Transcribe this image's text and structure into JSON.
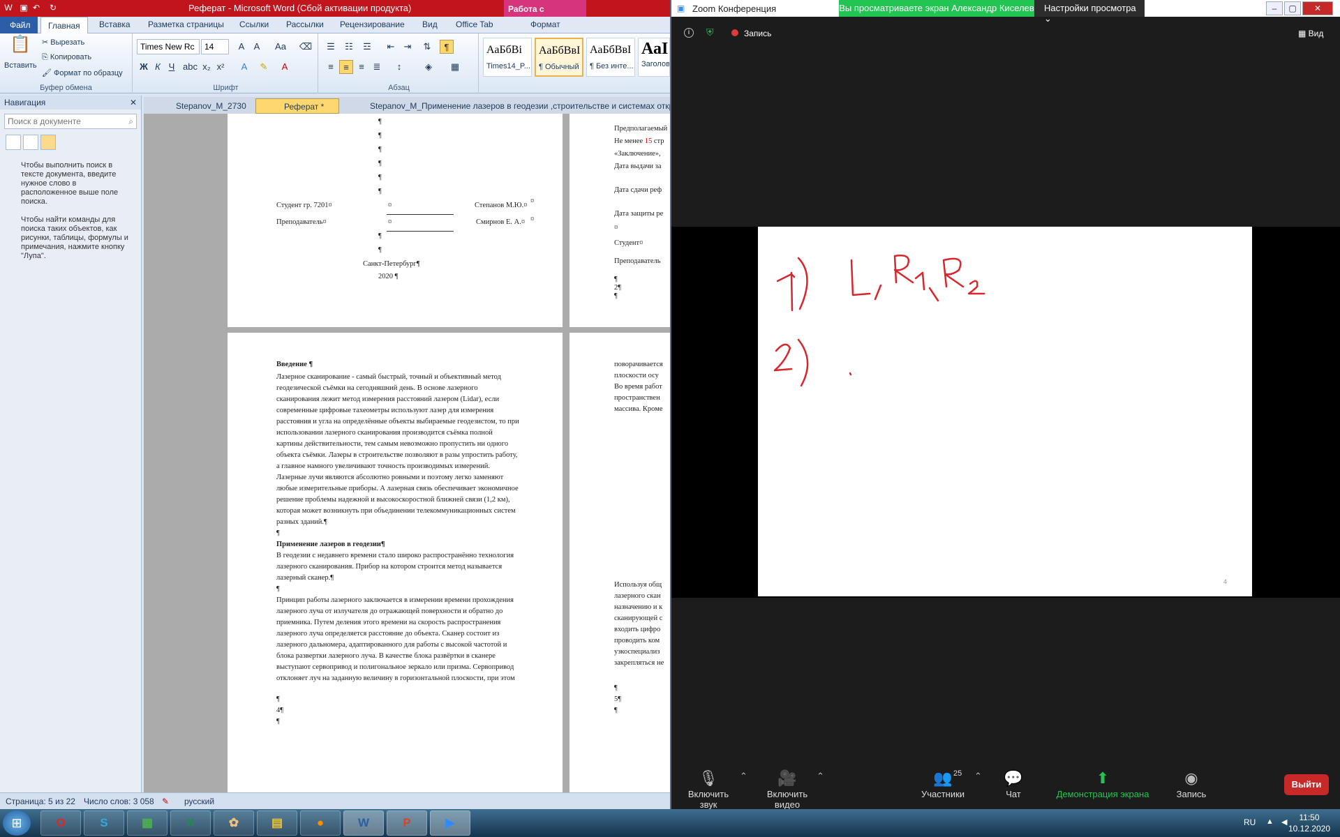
{
  "word": {
    "title": "Реферат  -  Microsoft Word (Сбой активации продукта)",
    "context_tab": "Работа с рисунками",
    "tabs": [
      "Файл",
      "Главная",
      "Вставка",
      "Разметка страницы",
      "Ссылки",
      "Рассылки",
      "Рецензирование",
      "Вид",
      "Office Tab",
      "Формат"
    ],
    "clipboard": {
      "paste": "Вставить",
      "cut": "Вырезать",
      "copy": "Копировать",
      "format_painter": "Формат по образцу",
      "group": "Буфер обмена"
    },
    "font": {
      "name": "Times New Rc",
      "size": "14",
      "group": "Шрифт"
    },
    "paragraph_group": "Абзац",
    "styles": [
      {
        "sample": "АаБбВі",
        "label": "Times14_P..."
      },
      {
        "sample": "АаБбВвІ",
        "label": "¶ Обычный"
      },
      {
        "sample": "АаБбВвІ",
        "label": "¶ Без инте..."
      },
      {
        "sample": "АаІ",
        "label": "Заголов..."
      }
    ],
    "navigation": {
      "title": "Навигация",
      "search_placeholder": "Поиск в документе",
      "msg1": "Чтобы выполнить поиск в тексте документа, введите нужное слово в расположенное выше поле поиска.",
      "msg2": "Чтобы найти команды для поиска таких объектов, как рисунки, таблицы, формулы и примечания, нажмите кнопку \"Лупа\"."
    },
    "doc_tabs": [
      "Stepanov_M_2730",
      "Реферат *",
      "Stepanov_M_Применение лазеров в геодезии ,строительстве и системах откры"
    ],
    "page1": {
      "pilcrows": [
        "¶",
        "¶",
        "¶",
        "¶",
        "¶",
        "¶"
      ],
      "student": "Студент гр. 7201¤",
      "student_cell": "¤",
      "student_name": "Степанов М.Ю.¤",
      "teacher": "Преподаватель¤",
      "teacher_cell": "¤",
      "teacher_name": "Смирнов Е. А.¤",
      "mark": "¤",
      "p1": "¶",
      "p2": "¶",
      "city": "Санкт-Петербург¶",
      "year": "2020 ¶"
    },
    "page2": {
      "l1": "Предполагаемый",
      "l2a": "Не менее ",
      "l2b": "15",
      "l2c": " стр",
      "l3": "«Заключение», ",
      "l4": "Дата выдачи за",
      "l5": "Дата сдачи реф",
      "l6": "Дата защиты ре",
      "l7": "¤",
      "l8": "Студент¤",
      "l9": "Преподаватель",
      "l10": "¶",
      "l11": "2¶",
      "l12": "¶"
    },
    "page3": {
      "h1": "Введение ¶",
      "lines": [
        "Лазерное сканирование - самый быстрый, точный и объективный метод",
        "геодезической съёмки на сегодняшний день. В основе лазерного",
        "сканирования лежит метод измерения расстояний лазером (Lidar), если",
        "современные цифровые тахеометры используют лазер для измерения",
        "расстояния и угла на определённые объекты выбираемые геодезистом, то при",
        "использовании лазерного сканирования производится съёмка полной",
        "картины действительности, тем самым невозможно пропустить ни одного",
        "объекта съёмки. Лазеры в строительстве позволяют в разы упростить работу,",
        "а главное намного увеличивают точность производимых измерений.",
        "Лазерные лучи являются абсолютно ровными и поэтому легко заменяют",
        "любые измерительные приборы. А лазерная связь обеспечивает экономичное",
        "решение проблемы надежной и высокоскоростной ближней связи (1,2 км),",
        "которая может возникнуть при объединении телекоммуникационных систем",
        "разных зданий.¶"
      ],
      "blank1": "¶",
      "h2": "Применение лазеров в геодезии¶",
      "lines2": [
        "В геодезии с недавнего времени стало широко распространённо технология",
        "лазерного сканирования. Прибор на котором строится метод называется",
        "лазерный сканер.¶"
      ],
      "blank2": "¶",
      "lines3": [
        "Принцип работы лазерного  заключается в измерении времени прохождения",
        "лазерного луча от излучателя до отражающей поверхности и обратно до",
        "приемника. Путем деления этого времени на скорость распространения",
        "лазерного луча определяется расстояние до объекта. Сканер состоит из",
        "лазерного дальномера, адаптированного для работы с высокой частотой и",
        "блока развертки лазерного луча. В качестве блока развёртки в сканере",
        "выступают сервопривод и полигональное зеркало или призма. Сервопривод",
        "отклоняет луч на заданную величину в горизонтальной плоскости, при этом"
      ],
      "foot": [
        "¶",
        "4¶",
        "¶"
      ]
    },
    "page4": {
      "lines": [
        "поворачивается",
        "плоскости осу",
        "Во время работ",
        "пространствен",
        "массива. Кроме"
      ],
      "lines2": [
        "Используя общ",
        "лазерного скан",
        "назначению и к",
        "сканирующей с",
        "входить цифро",
        "проводить ком",
        "узкоспециализ",
        "закрепляться не"
      ],
      "foot": [
        "¶",
        "5¶",
        "¶"
      ]
    },
    "status": {
      "page": "Страница: 5 из 22",
      "words": "Число слов: 3 058",
      "lang": "русский"
    }
  },
  "zoom": {
    "title": "Zoom Конференция",
    "banner": "Вы просматриваете экран Александр Киселев",
    "view_options": "Настройки просмотра",
    "recording": "Запись",
    "view": "Вид",
    "page_number": "4",
    "toolbar": {
      "mute": "Включить звук",
      "video": "Включить видео",
      "participants": "Участники",
      "participants_count": "25",
      "chat": "Чат",
      "share": "Демонстрация экрана",
      "record": "Запись",
      "leave": "Выйти"
    }
  },
  "taskbar": {
    "apps": [
      "Opera",
      "Skype",
      "Project",
      "Excel",
      "Paint",
      "Explorer",
      "Firefox",
      "Word",
      "PowerPoint",
      "Zoom"
    ],
    "lang": "RU",
    "time": "11:50",
    "date": "10.12.2020"
  },
  "colors": {
    "accent_word": "#2a5ea8",
    "title_red": "#c0151d",
    "zoom_green": "#23c552",
    "leave_red": "#c72828",
    "ink_red": "#d9262c"
  }
}
